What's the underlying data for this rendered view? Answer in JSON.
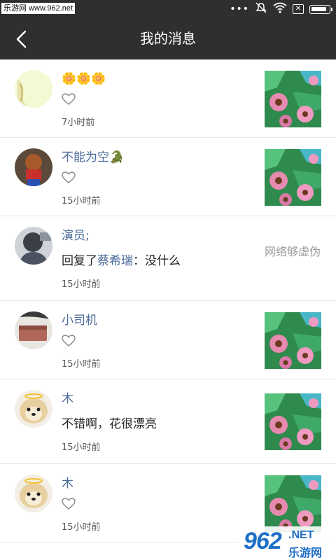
{
  "status_bar": {
    "watermark": "乐游网 www.962.net",
    "icons": [
      "more-dots-icon",
      "mute-icon",
      "wifi-icon",
      "no-sim-icon",
      "battery-icon"
    ],
    "battery_level": 0.85
  },
  "header": {
    "title": "我的消息",
    "back_icon": "chevron-left-icon"
  },
  "messages": [
    {
      "name": "🌼🌼🌼",
      "content_type": "like",
      "time": "7小时前",
      "thumb": "flower-photo"
    },
    {
      "name": "不能为空🐊",
      "content_type": "like",
      "time": "15小时前",
      "thumb": "flower-photo"
    },
    {
      "name": "演员;",
      "content_type": "reply",
      "reply_prefix": "回复了",
      "reply_to": "蔡希瑞",
      "reply_text": "：没什么",
      "time": "15小时前",
      "thumb_text": "网络够虚伪"
    },
    {
      "name": "小司机",
      "content_type": "like",
      "time": "15小时前",
      "thumb": "flower-photo"
    },
    {
      "name": "木",
      "content_type": "comment",
      "comment": "不错啊，花很漂亮",
      "time": "15小时前",
      "thumb": "flower-photo"
    },
    {
      "name": "木",
      "content_type": "like",
      "time": "15小时前",
      "thumb": "flower-photo"
    }
  ],
  "watermark_bottom": {
    "big": "962",
    "net": ".NET",
    "cn": "乐游网"
  },
  "colors": {
    "header_bg": "#2f2f2f",
    "name": "#4a6a9a",
    "divider": "#e6e6e6"
  }
}
